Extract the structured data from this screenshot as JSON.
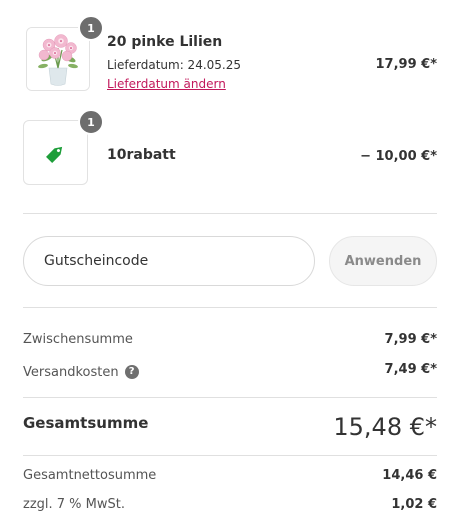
{
  "cart": {
    "items": [
      {
        "quantity": "1",
        "title": "20 pinke Lilien",
        "delivery": "Lieferdatum: 24.05.25",
        "change_link": "Lieferdatum ändern",
        "price": "17,99 €*"
      },
      {
        "quantity": "1",
        "title": "10rabatt",
        "price": "− 10,00 €*"
      }
    ]
  },
  "coupon": {
    "placeholder": "Gutscheincode",
    "apply_label": "Anwenden"
  },
  "summary": {
    "subtotal_label": "Zwischensumme",
    "subtotal_value": "7,99 €*",
    "shipping_label": "Versandkosten",
    "shipping_value": "7,49 €*",
    "help_glyph": "?",
    "total_label": "Gesamtsumme",
    "total_value": "15,48 €*",
    "net_label": "Gesamtnettosumme",
    "net_value": "14,46 €",
    "vat_label": "zzgl. 7 % MwSt.",
    "vat_value": "1,02 €"
  },
  "icons": {
    "product_image": "lilies-bouquet-image",
    "discount": "price-tag-icon",
    "help": "question-circle-icon"
  },
  "colors": {
    "link": "#c2185b",
    "discount_tag": "#1e9e3a",
    "badge": "#6d6d6d"
  }
}
